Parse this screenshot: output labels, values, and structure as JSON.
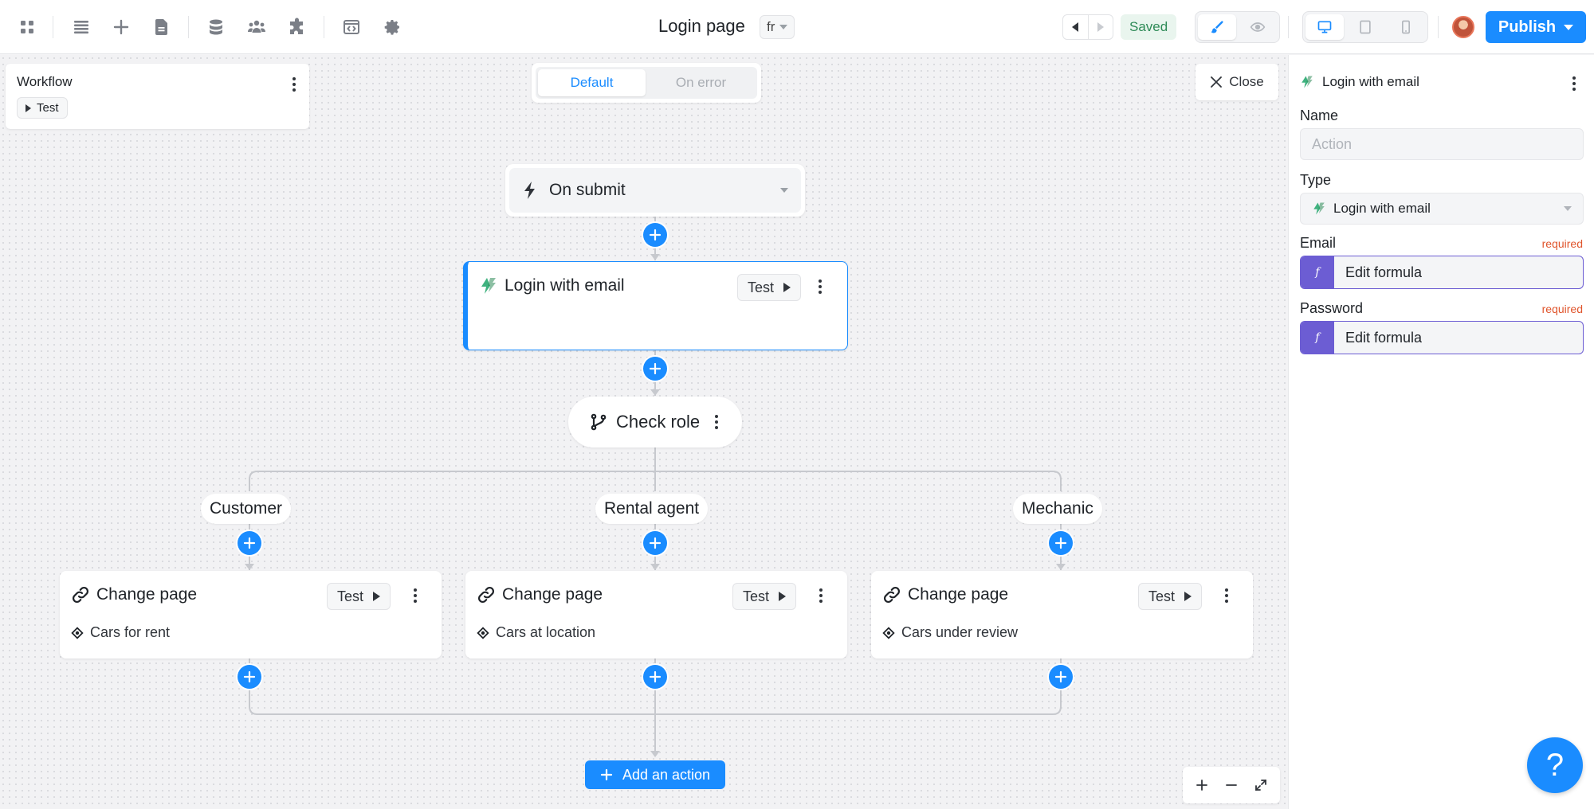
{
  "header": {
    "page_title": "Login page",
    "lang": "fr",
    "status": "Saved",
    "publish_label": "Publish",
    "left_icons": [
      "apps-icon",
      "layers-icon",
      "add-icon",
      "document-icon",
      "database-icon",
      "users-icon",
      "plugin-icon",
      "code-icon",
      "gear-icon"
    ],
    "mode_icons": [
      "edit-brush-icon",
      "preview-eye-icon"
    ],
    "device_icons": [
      "desktop-icon",
      "tablet-icon",
      "mobile-icon"
    ]
  },
  "colors": {
    "accent": "#1a8cff",
    "formula": "#6c5dd3",
    "success": "#2e8b57",
    "required": "#e0552c",
    "auth": "#3fb27f"
  },
  "workflow_card": {
    "title": "Workflow",
    "test_label": "Test"
  },
  "tabs": {
    "default": "Default",
    "on_error": "On error"
  },
  "close_label": "Close",
  "trigger": {
    "label": "On submit",
    "icon": "lightning-icon"
  },
  "login_node": {
    "title": "Login with email",
    "test_label": "Test",
    "icon": "auth-icon"
  },
  "branch_node": {
    "title": "Check role",
    "icon": "branch-icon"
  },
  "branches": [
    {
      "label": "Customer",
      "action": "Change page",
      "test_label": "Test",
      "target": "Cars for rent"
    },
    {
      "label": "Rental agent",
      "action": "Change page",
      "test_label": "Test",
      "target": "Cars at location"
    },
    {
      "label": "Mechanic",
      "action": "Change page",
      "test_label": "Test",
      "target": "Cars under review"
    }
  ],
  "add_action_label": "Add an action",
  "zoom_icons": [
    "zoom-in-icon",
    "zoom-out-icon",
    "fit-screen-icon"
  ],
  "panel": {
    "title": "Login with email",
    "name_label": "Name",
    "name_placeholder": "Action",
    "type_label": "Type",
    "type_value": "Login with email",
    "email_label": "Email",
    "password_label": "Password",
    "required_label": "required",
    "formula_tag": "f",
    "formula_placeholder": "Edit formula"
  },
  "help_label": "?"
}
